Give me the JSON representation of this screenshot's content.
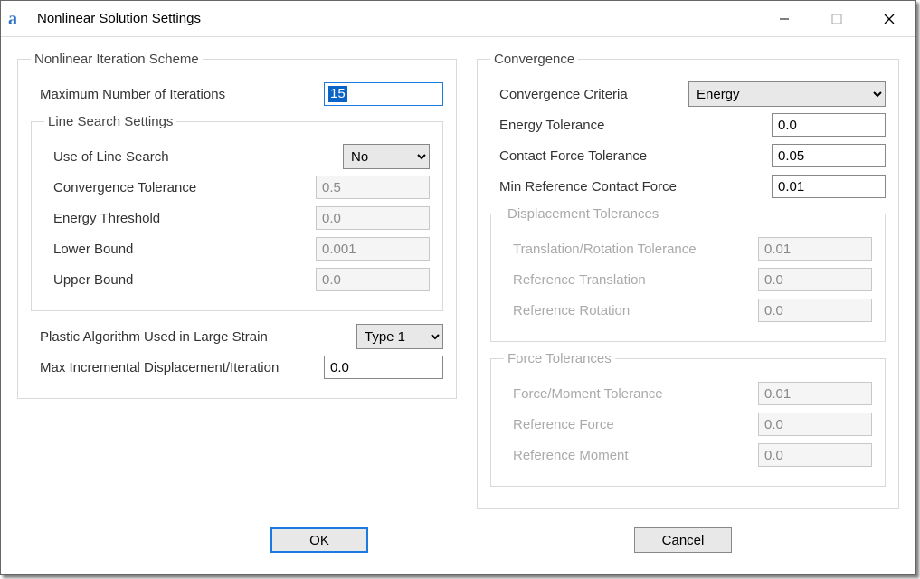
{
  "window": {
    "title": "Nonlinear Solution Settings"
  },
  "left": {
    "group": "Nonlinear Iteration Scheme",
    "max_iter": {
      "label": "Maximum Number of Iterations",
      "value": "15"
    },
    "line_search": {
      "group": "Line Search Settings",
      "use": {
        "label": "Use of Line Search",
        "value": "No"
      },
      "conv_tol": {
        "label": "Convergence Tolerance",
        "value": "0.5"
      },
      "energy_th": {
        "label": "Energy Threshold",
        "value": "0.0"
      },
      "lower": {
        "label": "Lower Bound",
        "value": "0.001"
      },
      "upper": {
        "label": "Upper Bound",
        "value": "0.0"
      }
    },
    "plastic_alg": {
      "label": "Plastic Algorithm Used in Large Strain",
      "value": "Type 1"
    },
    "max_inc_disp": {
      "label": "Max Incremental Displacement/Iteration",
      "value": "0.0"
    }
  },
  "right": {
    "group": "Convergence",
    "criteria": {
      "label": "Convergence Criteria",
      "value": "Energy"
    },
    "energy_tol": {
      "label": "Energy Tolerance",
      "value": "0.0"
    },
    "contact_tol": {
      "label": "Contact Force Tolerance",
      "value": "0.05"
    },
    "min_ref_cf": {
      "label": "Min Reference Contact Force",
      "value": "0.01"
    },
    "disp": {
      "group": "Displacement Tolerances",
      "tr_tol": {
        "label": "Translation/Rotation Tolerance",
        "value": "0.01"
      },
      "ref_tr": {
        "label": "Reference Translation",
        "value": "0.0"
      },
      "ref_rot": {
        "label": "Reference Rotation",
        "value": "0.0"
      }
    },
    "force": {
      "group": "Force Tolerances",
      "fm_tol": {
        "label": "Force/Moment Tolerance",
        "value": "0.01"
      },
      "ref_f": {
        "label": "Reference Force",
        "value": "0.0"
      },
      "ref_m": {
        "label": "Reference Moment",
        "value": "0.0"
      }
    }
  },
  "buttons": {
    "ok": "OK",
    "cancel": "Cancel"
  }
}
